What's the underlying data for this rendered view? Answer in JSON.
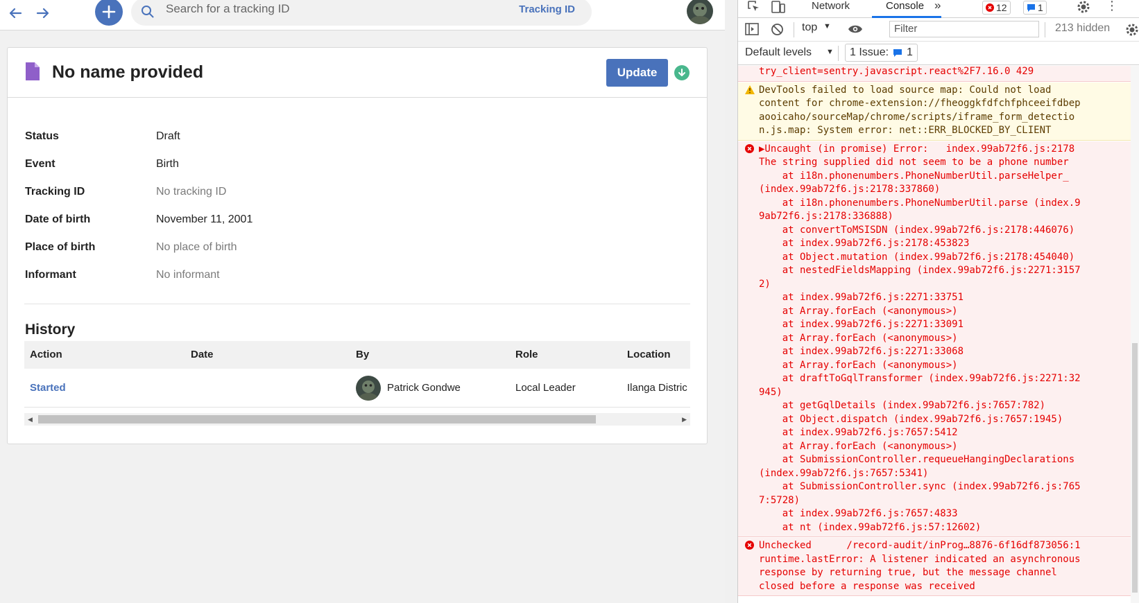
{
  "topbar": {
    "search_placeholder": "Search for a tracking ID",
    "search_type": "Tracking ID"
  },
  "record": {
    "title": "No name provided",
    "update_label": "Update",
    "details": [
      {
        "label": "Status",
        "value": "Draft",
        "muted": false
      },
      {
        "label": "Event",
        "value": "Birth",
        "muted": false
      },
      {
        "label": "Tracking ID",
        "value": "No tracking ID",
        "muted": true
      },
      {
        "label": "Date of birth",
        "value": "November 11, 2001",
        "muted": false
      },
      {
        "label": "Place of birth",
        "value": "No place of birth",
        "muted": true
      },
      {
        "label": "Informant",
        "value": "No informant",
        "muted": true
      }
    ]
  },
  "history": {
    "title": "History",
    "columns": [
      "Action",
      "Date",
      "By",
      "Role",
      "Location"
    ],
    "rows": [
      {
        "action": "Started",
        "date": "",
        "by": "Patrick Gondwe",
        "role": "Local Leader",
        "location": "Ilanga Distric"
      }
    ]
  },
  "devtools": {
    "tabs": [
      "Network",
      "Console"
    ],
    "active_tab": "Console",
    "error_count": "12",
    "message_count": "1",
    "context": "top",
    "filter_placeholder": "Filter",
    "hidden_count": "213 hidden",
    "levels_label": "Default levels",
    "issues_label": "1 Issue:",
    "issues_count": "1",
    "messages": [
      {
        "type": "error",
        "lines": [
          "try_client=sentry.javascript.react%2F7.16.0 429"
        ]
      },
      {
        "type": "warning",
        "lines": [
          "DevTools failed to load source map: Could not load",
          "content for chrome-extension://fheoggkfdfchfphceeifdbep",
          "aooicaho/sourceMap/chrome/scripts/iframe_form_detectio",
          "n.js.map: System error: net::ERR_BLOCKED_BY_CLIENT"
        ]
      },
      {
        "type": "error",
        "lines": [
          "▶Uncaught (in promise) Error:   index.99ab72f6.js:2178",
          "The string supplied did not seem to be a phone number",
          "    at i18n.phonenumbers.PhoneNumberUtil.parseHelper_",
          "(index.99ab72f6.js:2178:337860)",
          "    at i18n.phonenumbers.PhoneNumberUtil.parse (index.9",
          "9ab72f6.js:2178:336888)",
          "    at convertToMSISDN (index.99ab72f6.js:2178:446076)",
          "    at index.99ab72f6.js:2178:453823",
          "    at Object.mutation (index.99ab72f6.js:2178:454040)",
          "    at nestedFieldsMapping (index.99ab72f6.js:2271:3157",
          "2)",
          "    at index.99ab72f6.js:2271:33751",
          "    at Array.forEach (<anonymous>)",
          "    at index.99ab72f6.js:2271:33091",
          "    at Array.forEach (<anonymous>)",
          "    at index.99ab72f6.js:2271:33068",
          "    at Array.forEach (<anonymous>)",
          "    at draftToGqlTransformer (index.99ab72f6.js:2271:32",
          "945)",
          "    at getGqlDetails (index.99ab72f6.js:7657:782)",
          "    at Object.dispatch (index.99ab72f6.js:7657:1945)",
          "    at index.99ab72f6.js:7657:5412",
          "    at Array.forEach (<anonymous>)",
          "    at SubmissionController.requeueHangingDeclarations",
          "(index.99ab72f6.js:7657:5341)",
          "    at SubmissionController.sync (index.99ab72f6.js:765",
          "7:5728)",
          "    at index.99ab72f6.js:7657:4833",
          "    at nt (index.99ab72f6.js:57:12602)"
        ]
      },
      {
        "type": "error",
        "lines": [
          "Unchecked      /record-audit/inProg…8876-6f16df873056:1",
          "runtime.lastError: A listener indicated an asynchronous",
          "response by returning true, but the message channel",
          "closed before a response was received"
        ]
      }
    ]
  }
}
